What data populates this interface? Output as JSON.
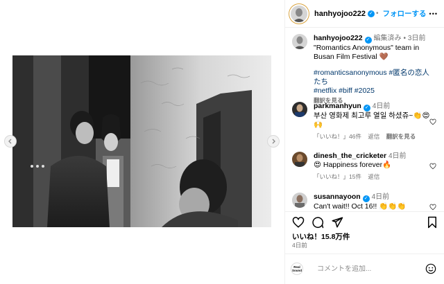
{
  "header": {
    "username": "hanhyojoo222",
    "separator": "•",
    "follow_label": "フォローする",
    "more_label": "•••"
  },
  "caption": {
    "username": "hanhyojoo222",
    "edited": "編集済み",
    "separator": "•",
    "time": "3日前",
    "text": "\"Romantics Anonymous\" team in Busan Film Festival 🤎",
    "hashtags_line1": "#romanticsanonymous #匿名の恋人たち",
    "hashtags_line2": "#netflix #biff #2025",
    "translate": "翻訳を見る"
  },
  "comments": [
    {
      "username": "parkmanhyun",
      "time": "4日前",
      "text": "부산 영화제 최고루 열일 하셨쥬~👏😍🙌",
      "likes": "「いいね！」46件",
      "reply": "返信",
      "translate": "翻訳を見る"
    },
    {
      "username": "dinesh_the_cricketer",
      "time": "4日前",
      "text": "😍 Happiness forever🔥",
      "likes": "「いいね！」15件",
      "reply": "返信"
    },
    {
      "username": "susannayoon",
      "time": "4日前",
      "text": "Can't wait!! Oct 16!! 👏👏👏"
    }
  ],
  "post": {
    "likes": "いいね！15.8万件",
    "date": "4日前"
  },
  "composer": {
    "placeholder": "コメントを追加...",
    "avatar_label": "Real Sound"
  },
  "icons": [
    "prev-arrow-icon",
    "next-arrow-icon",
    "verified-icon",
    "more-icon",
    "heart-icon",
    "comment-icon",
    "share-icon",
    "bookmark-icon",
    "emoji-icon"
  ],
  "colors": {
    "accent": "#0095f6",
    "hashtag": "#00376b",
    "gray": "#737373",
    "like": "#000000"
  }
}
